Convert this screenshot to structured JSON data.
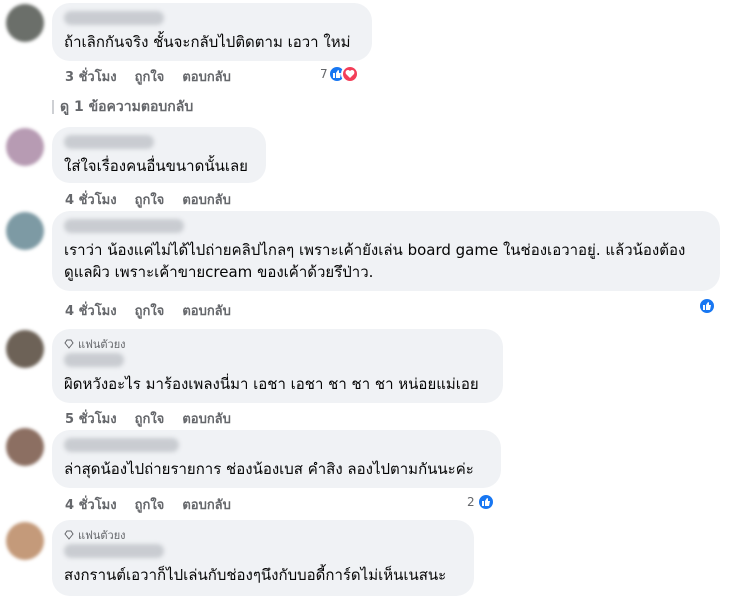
{
  "comments": [
    {
      "text": "ถ้าเลิกกันจริง ชั้นจะกลับไปติดตาม เอวา ใหม่",
      "time": "3 ชั่วโมง",
      "reaction_count": "7"
    },
    {
      "text": "ใส่ใจเรื่องคนอื่นขนาดนั้นเลย",
      "time": "4 ชั่วโมง"
    },
    {
      "text": "เราว่า น้องแค่ไม่ได้ไปถ่ายคลิปไกลๆ เพราะเค้ายังเล่น board game ในช่องเอวาอยู่. แล้วน้องต้องดูแลผิว เพราะเค้าขายcream ของเค้าด้วยรึป่าว.",
      "time": "4 ชั่วโมง"
    },
    {
      "badge": "แฟนตัวยง",
      "text": "ผิดหวังอะไร มาร้องเพลงนี่มา เอชา เอชา ชา ชา ชา หน่อยแม่เอย",
      "time": "5 ชั่วโมง"
    },
    {
      "text": "ล่าสุดน้องไปถ่ายรายการ ช่องน้องเบส คำสิง ลองไปตามกันนะค่ะ",
      "time": "4 ชั่วโมง",
      "reaction_count": "2"
    },
    {
      "badge": "แฟนตัวยง",
      "text": "สงกรานต์เอวาก็ไปเล่นกับช่องๆนึงกับบอดี้การ์ดไม่เห็นเนสนะ"
    }
  ],
  "actions": {
    "like": "ถูกใจ",
    "reply": "ตอบกลับ"
  },
  "view_replies": "ดู 1 ข้อความตอบกลับ",
  "colors": {
    "like": "#1877f2",
    "love": "#f33e58",
    "bubble": "#f0f2f5",
    "meta": "#65676b"
  }
}
